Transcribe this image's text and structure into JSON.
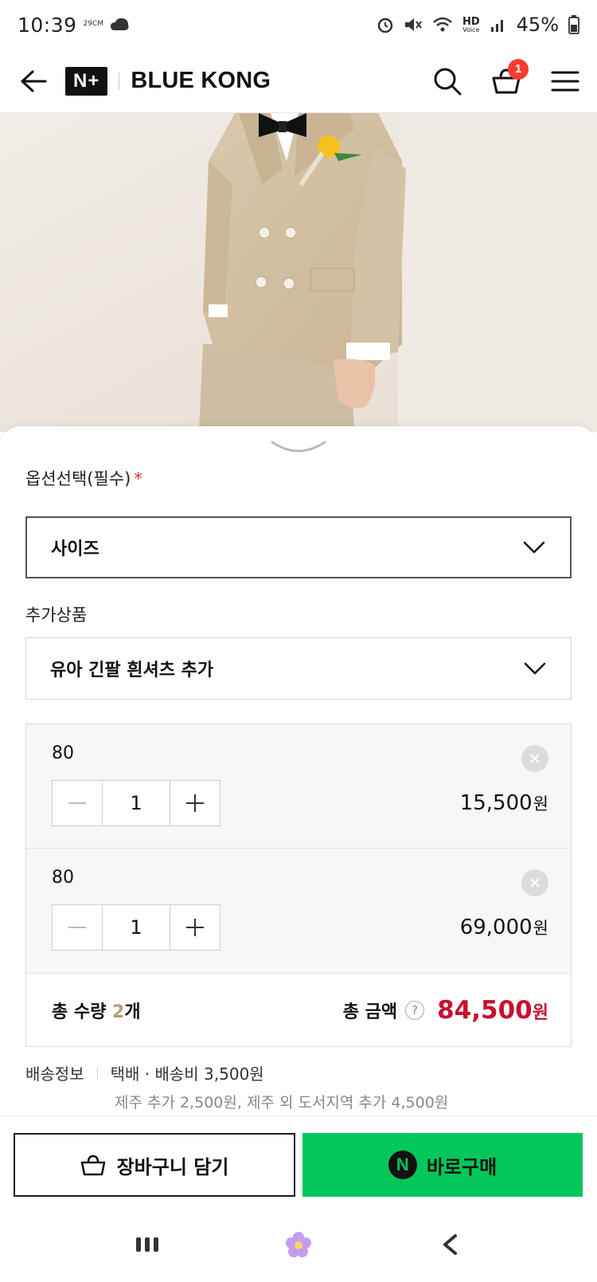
{
  "status_bar": {
    "time": "10:39",
    "small_text": "29CM",
    "battery": "45%",
    "hd_label": "HD",
    "voice_label": "Voice"
  },
  "header": {
    "brand_badge": "N+",
    "store_name": "BLUE KONG",
    "cart_count": "1"
  },
  "options": {
    "label": "옵션선택(필수)",
    "required_mark": "*",
    "size_select": "사이즈",
    "addon_label": "추가상품",
    "addon_select": "유아 긴팔 흰셔츠 추가"
  },
  "items": [
    {
      "option": "80",
      "quantity": "1",
      "price": "15,500",
      "unit": "원"
    },
    {
      "option": "80",
      "quantity": "1",
      "price": "69,000",
      "unit": "원"
    }
  ],
  "total": {
    "qty_prefix": "총 수량 ",
    "qty_value": "2",
    "qty_suffix": "개",
    "amount_label": "총 금액",
    "help": "?",
    "amount": "84,500",
    "unit": "원"
  },
  "shipping": {
    "label": "배송정보",
    "main": "택배 · 배송비 3,500원",
    "extra": "제주 추가 2,500원, 제주 외 도서지역 추가 4,500원"
  },
  "actions": {
    "cart_button": "장바구니 담기",
    "buy_badge": "N",
    "buy_button": "바로구매"
  },
  "icons": {
    "back": "back-arrow-icon",
    "search": "search-icon",
    "cart": "basket-icon",
    "menu": "hamburger-icon",
    "remove": "close-icon",
    "chevron": "chevron-down-icon"
  },
  "colors": {
    "accent_green": "#03c75a",
    "price_red": "#c8102e",
    "badge_red": "#ff3b2f"
  }
}
